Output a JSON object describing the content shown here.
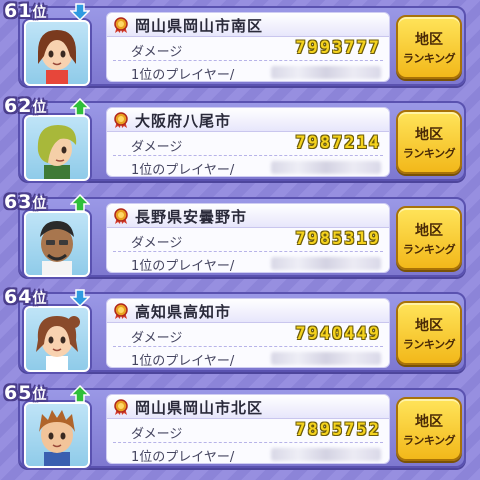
{
  "labels": {
    "damage": "ダメージ",
    "top_player": "1位のプレイヤー/",
    "button_line1": "地区",
    "button_line2": "ランキング",
    "rank_suffix": "位"
  },
  "rows": [
    {
      "rank": "61",
      "trend": "down",
      "city": "岡山県岡山市南区",
      "damage": "7993777"
    },
    {
      "rank": "62",
      "trend": "up",
      "city": "大阪府八尾市",
      "damage": "7987214"
    },
    {
      "rank": "63",
      "trend": "up",
      "city": "長野県安曇野市",
      "damage": "7985319"
    },
    {
      "rank": "64",
      "trend": "down",
      "city": "高知県高知市",
      "damage": "7940449"
    },
    {
      "rank": "65",
      "trend": "up",
      "city": "岡山県岡山市北区",
      "damage": "7895752"
    }
  ],
  "colors": {
    "up_arrow": "#2fbf3a",
    "down_arrow": "#2f9be0",
    "damage_text": "#f5d31e",
    "button": "#f7c82a"
  }
}
